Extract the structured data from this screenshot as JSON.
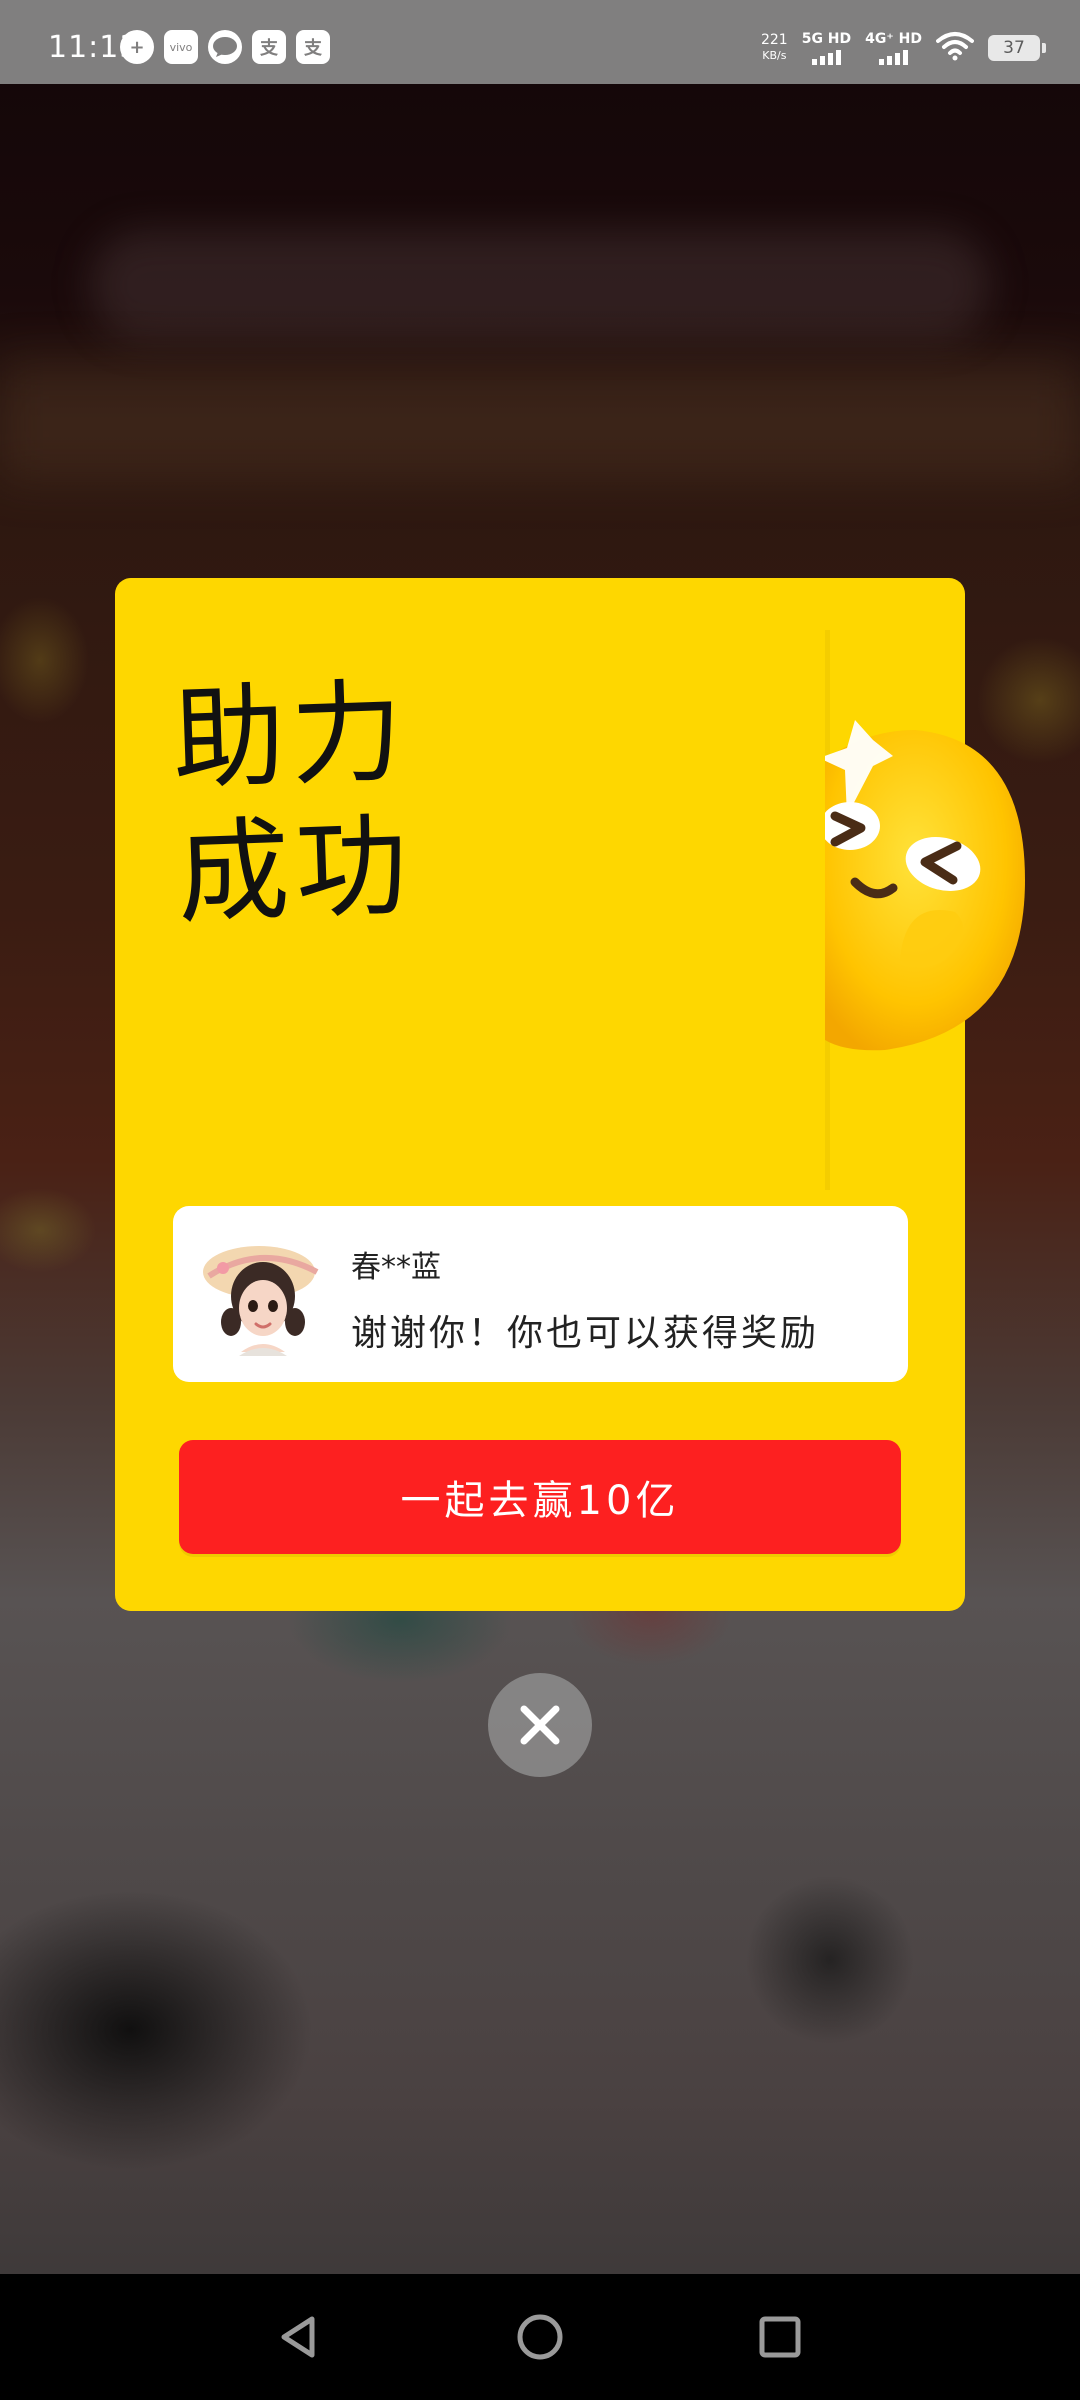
{
  "status_bar": {
    "time": "11:13",
    "app_icons": [
      "plus-circle-icon",
      "vivo-icon",
      "message-bubble-icon",
      "alipay-icon",
      "alipay-icon"
    ],
    "vivo_label": "vivo",
    "alipay_glyph": "支",
    "net_speed_value": "221",
    "net_speed_unit": "KB/s",
    "signal_1_label": "5G HD",
    "signal_2_label": "4G⁺ HD",
    "battery_level": "37"
  },
  "dialog": {
    "title_line1": "助力",
    "title_line2": "成功",
    "friend_name": "春**蓝",
    "friend_message": "谢谢你！你也可以获得奖励",
    "cta_label": "一起去赢10亿",
    "colors": {
      "background": "#fed700",
      "button": "#fd2020",
      "card": "#ffffff"
    }
  },
  "nav_bar": {
    "back_icon": "triangle-back-icon",
    "home_icon": "circle-home-icon",
    "recents_icon": "square-recents-icon"
  }
}
